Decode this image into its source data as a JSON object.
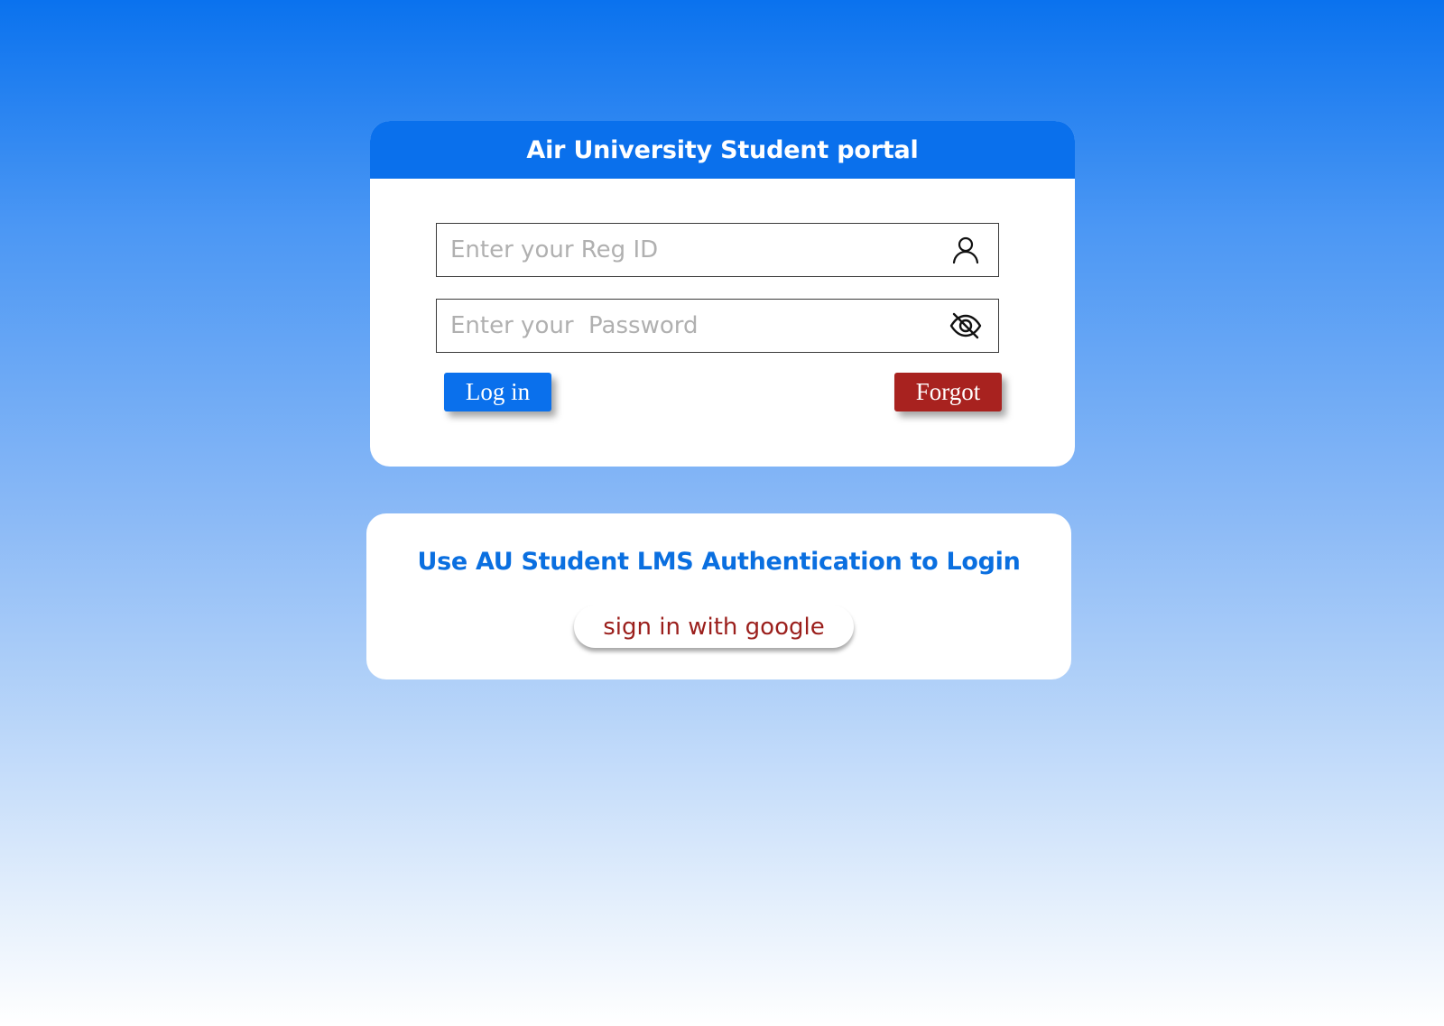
{
  "login_card": {
    "title": "Air University Student portal",
    "reg_id": {
      "placeholder": "Enter your Reg ID",
      "value": "",
      "icon": "user-icon"
    },
    "password": {
      "placeholder": "Enter your  Password",
      "value": "",
      "icon": "eye-slash-icon"
    },
    "login_label": "Log in",
    "forgot_label": "Forgot"
  },
  "auth_card": {
    "heading": "Use AU Student LMS Authentication to Login",
    "google_label": "sign in with google"
  },
  "colors": {
    "primary_blue": "#0a70ec",
    "forgot_red": "#a8221f",
    "google_text": "#9b1f1c"
  }
}
